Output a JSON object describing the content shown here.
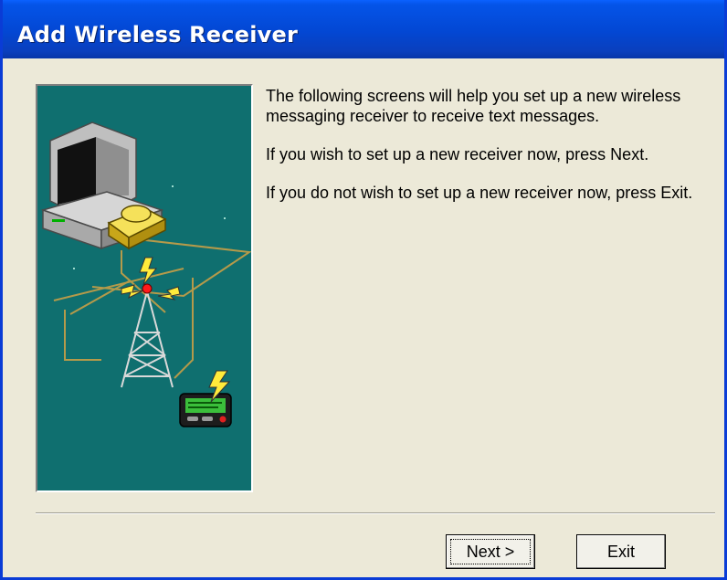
{
  "window": {
    "title": "Add Wireless Receiver"
  },
  "illustration": {
    "name": "wireless-setup-illustration",
    "background": "#0f6f6f"
  },
  "message": {
    "paragraphs": [
      "The following screens will help you set up a new wireless messaging receiver to receive text messages.",
      "If you wish to set up a new receiver now, press Next.",
      "If you do not wish to set up a new receiver now, press Exit."
    ]
  },
  "buttons": {
    "next_label": "Next >",
    "exit_label": "Exit"
  },
  "colors": {
    "titlebar": "#0347d3",
    "dialog_face": "#ece9d8",
    "illustration_bg": "#0f6f6f"
  }
}
